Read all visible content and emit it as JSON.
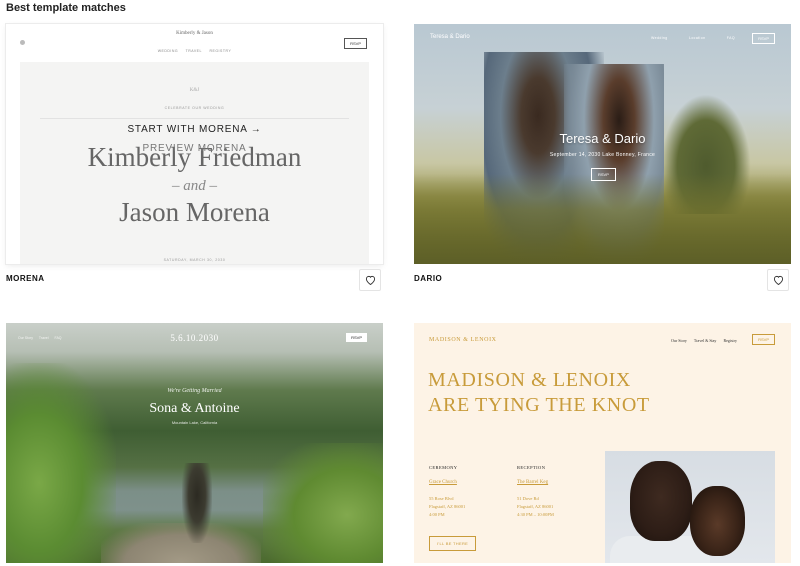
{
  "heading": "Best template matches",
  "colors": {
    "gold": "#c89b3a",
    "cream": "#fdf3e6"
  },
  "cards": [
    {
      "name": "MORENA",
      "preview": {
        "site_title": "Kimberly & Jason",
        "nav": [
          "WEDDING",
          "TRAVEL",
          "REGISTRY"
        ],
        "rsvp": "RSVP",
        "monogram": "K&J",
        "celebrate": "CELEBRATE OUR WEDDING",
        "name1": "Kimberly Friedman",
        "and": "– and –",
        "name2": "Jason Morena",
        "date": "SATURDAY, MARCH 30, 2030"
      },
      "hover_actions": {
        "start": "START WITH MORENA →",
        "preview": "PREVIEW MORENA"
      }
    },
    {
      "name": "DARIO",
      "preview": {
        "site_title": "Teresa & Dario",
        "nav": [
          "Wedding",
          "Location",
          "FAQ"
        ],
        "rsvp": "RSVP",
        "title": "Teresa & Dario",
        "subtitle": "September 14, 2030 Lake Bonney, France",
        "button": "RSVP"
      }
    },
    {
      "name": "",
      "preview": {
        "nav": [
          "Our Story",
          "Travel",
          "FAQ"
        ],
        "date": "5.6.10.2030",
        "rsvp": "RSVP",
        "kicker": "We're Getting Married",
        "title": "Sona & Antoine",
        "subtitle": "Mountain Lake, California"
      }
    },
    {
      "name": "",
      "preview": {
        "logo": "MADISON & LENOIX",
        "nav": [
          "Our Story",
          "Travel & Stay",
          "Registry"
        ],
        "rsvp": "RSVP",
        "title_line1": "MADISON & LENOIX",
        "title_line2": "ARE TYING THE KNOT",
        "ceremony_heading": "CEREMONY",
        "ceremony_link": "Grace Church",
        "ceremony_lines": [
          "55 Rose Blvd",
          "Flagstaff, AZ 86001",
          "4:00 PM"
        ],
        "reception_heading": "RECEPTION",
        "reception_link": "The Barrel Keg",
        "reception_lines": [
          "51 Dove Rd",
          "Flagstaff, AZ 86001",
          "4:30 PM – 10:00PM"
        ],
        "button": "I'LL BE THERE"
      }
    }
  ],
  "icons": {
    "favorite": "heart-icon"
  }
}
